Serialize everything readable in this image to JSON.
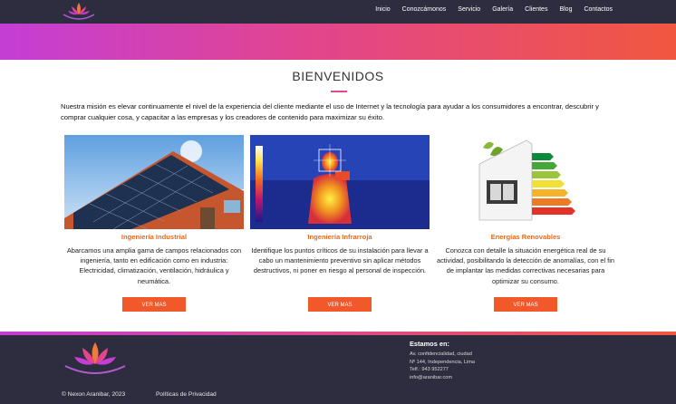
{
  "nav": {
    "items": [
      "Inicio",
      "Conozcámonos",
      "Servicio",
      "Galería",
      "Clientes",
      "Blog",
      "Contactos"
    ]
  },
  "main": {
    "title": "BIENVENIDOS",
    "intro": "Nuestra misión es elevar continuamente el nivel de la experiencia del cliente mediante el uso de Internet y la tecnología para ayudar a los consumidores a encontrar, descubrir y comprar cualquier cosa, y capacitar a las empresas y los creadores de contenido para maximizar su éxito."
  },
  "cards": [
    {
      "title": "Ingeniería Industrial",
      "text": "Abarcamos una amplia gama de campos relacionados con ingeniería, tanto en edificación como en industria: Electricidad, climatización, ventilación, hidráulica y neumática.",
      "button": "VER MAS",
      "image": "solar-roof"
    },
    {
      "title": "Ingeniería Infrarroja",
      "text": "Identifique los puntos críticos de su instalación para llevar a cabo un mantenimiento preventivo sin aplicar métodos destructivos, ni poner en riesgo al personal de inspección.",
      "button": "VER MAS",
      "image": "thermal-camera"
    },
    {
      "title": "Energías Renovables",
      "text": "Conozca con detalle la situación energética real de su actividad, posibilitando la detección de anomalías, con el fin de implantar las medidas correctivas necesarias para optimizar su consumo.",
      "button": "VER MAS",
      "image": "energy-rating-house"
    }
  ],
  "footer": {
    "copyright": "© Nexon Aranibar, 2023",
    "privacy": "Políticas de Privacidad",
    "contact_title": "Estamos en:",
    "contact_lines": [
      "Av. confidencialidad, ciudad",
      "Nº 144, Independencia, Lima",
      "Telf.: 943 952277",
      "info@aranibar.com"
    ]
  },
  "colors": {
    "nav_bg": "#2d2d3f",
    "gradient_start": "#c43ed6",
    "gradient_end": "#f1573f",
    "accent_orange": "#f2592a",
    "card_title": "#e36b1f"
  }
}
